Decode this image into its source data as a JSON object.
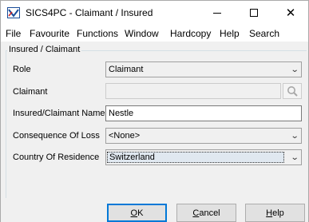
{
  "window": {
    "title": "SICS4PC - Claimant / Insured",
    "app_icon": "sics-app-icon"
  },
  "menu": {
    "items": [
      "File",
      "Favourite",
      "Functions",
      "Window",
      "Hardcopy",
      "Help",
      "Search"
    ]
  },
  "group": {
    "label": "Insured / Claimant"
  },
  "fields": {
    "role": {
      "label": "Role",
      "value": "Claimant"
    },
    "claimant": {
      "label": "Claimant",
      "value": ""
    },
    "insured": {
      "label": "Insured/Claimant Name",
      "value": "Nestle"
    },
    "consequence": {
      "label": "Consequence Of Loss",
      "value": "<None>"
    },
    "country": {
      "label": "Country Of Residence",
      "value": "Switzerland"
    }
  },
  "buttons": {
    "ok_first": "O",
    "ok_rest": "K",
    "cancel_first": "C",
    "cancel_rest": "ancel",
    "help_first": "H",
    "help_rest": "elp"
  },
  "colors": {
    "focus_border": "#0078d7",
    "panel_bg": "#f0f0f0"
  }
}
